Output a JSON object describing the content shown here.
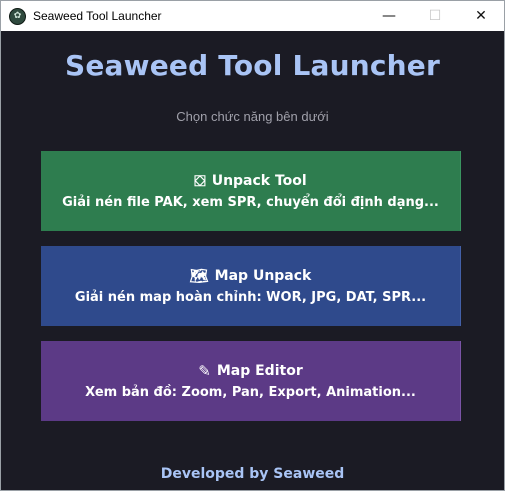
{
  "window": {
    "title": "Seaweed Tool Launcher",
    "controls": {
      "minimize": "—",
      "maximize": "☐",
      "close": "✕"
    }
  },
  "main": {
    "heading": "Seaweed Tool Launcher",
    "subtitle": "Chọn chức năng bên dưới",
    "tools": [
      {
        "title": "Unpack Tool",
        "desc": "Giải nén file PAK, xem SPR, chuyển đổi định dạng...",
        "icon": "package-icon",
        "color": "#2e7d4f"
      },
      {
        "title": "Map Unpack",
        "desc": "Giải nén map hoàn chỉnh: WOR, JPG, DAT, SPR...",
        "icon": "map-icon",
        "color": "#2f4a8c"
      },
      {
        "title": "Map Editor",
        "desc": "Xem bản đồ: Zoom, Pan, Export, Animation...",
        "icon": "pencil-icon",
        "color": "#5c3a86"
      }
    ]
  },
  "footer": {
    "text": "Developed by Seaweed"
  }
}
